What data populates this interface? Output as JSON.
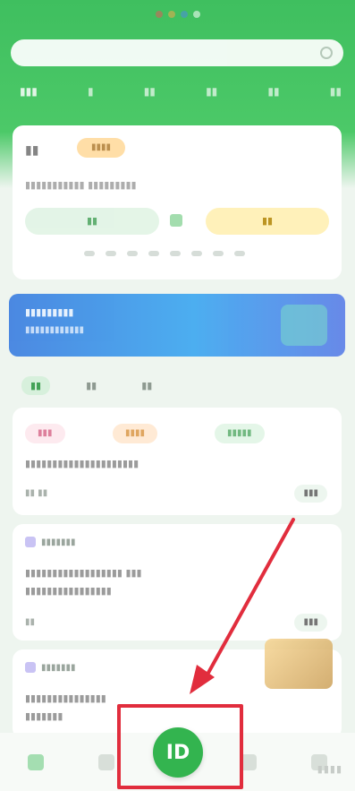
{
  "header": {
    "search_placeholder": "",
    "tabs": [
      {
        "label": ""
      },
      {
        "label": ""
      },
      {
        "label": ""
      },
      {
        "label": ""
      },
      {
        "label": ""
      },
      {
        "label": ""
      }
    ]
  },
  "main_card": {
    "title": "",
    "tag": "",
    "description": "",
    "left_button": "",
    "right_button": ""
  },
  "banner": {
    "line1": "",
    "line2": ""
  },
  "feed_tabs": [
    {
      "label": ""
    },
    {
      "label": ""
    },
    {
      "label": ""
    }
  ],
  "feed": [
    {
      "chips": [
        "",
        "",
        ""
      ],
      "text": "",
      "meta": "",
      "badge": ""
    },
    {
      "source": "",
      "text": "",
      "text2": "",
      "meta": "",
      "badge": ""
    },
    {
      "source": "",
      "text": "",
      "text2": ""
    }
  ],
  "bottom_nav": {
    "center_label": "ID",
    "items": [
      {
        "icon": "home-icon"
      },
      {
        "icon": "list-icon"
      },
      {
        "icon": "center-app-icon"
      },
      {
        "icon": "chat-icon"
      },
      {
        "icon": "profile-icon"
      }
    ]
  },
  "annotation": {
    "arrow_color": "#e12d3d",
    "box_color": "#e12d3d"
  },
  "colors": {
    "brand_green": "#33b44f",
    "header_green": "#3fbf5f"
  }
}
